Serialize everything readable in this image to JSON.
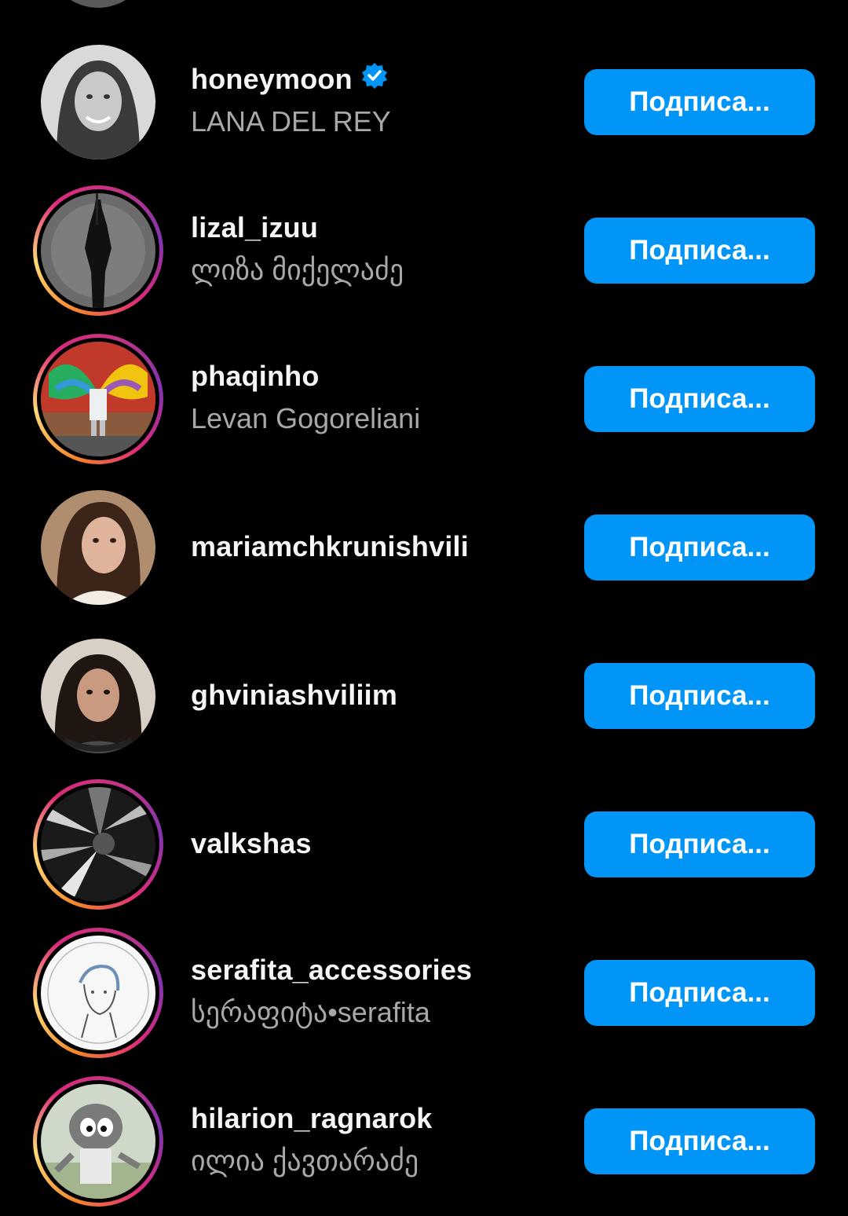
{
  "colors": {
    "background": "#000000",
    "follow_button": "#0095f6",
    "username_text": "#f5f5f5",
    "fullname_text": "#a8a8a8",
    "verified_badge": "#0095f6"
  },
  "rows": [
    {
      "username": "honeymoon",
      "fullname": "LANA DEL REY",
      "verified": true,
      "story_ring": false,
      "button_label": "Подписа..."
    },
    {
      "username": "lizal_izuu",
      "fullname": "ლიზა მიქელაძე",
      "verified": false,
      "story_ring": true,
      "button_label": "Подписа..."
    },
    {
      "username": "phaqinho",
      "fullname": "Levan Gogoreliani",
      "verified": false,
      "story_ring": true,
      "button_label": "Подписа..."
    },
    {
      "username": "mariamchkrunishvili",
      "fullname": "",
      "verified": false,
      "story_ring": false,
      "button_label": "Подписа..."
    },
    {
      "username": "ghviniashviliim",
      "fullname": "",
      "verified": false,
      "story_ring": false,
      "button_label": "Подписа..."
    },
    {
      "username": "valkshas",
      "fullname": "",
      "verified": false,
      "story_ring": true,
      "button_label": "Подписа..."
    },
    {
      "username": "serafita_accessories",
      "fullname": "სერაფიტა•serafita",
      "verified": false,
      "story_ring": true,
      "button_label": "Подписа..."
    },
    {
      "username": "hilarion_ragnarok",
      "fullname": "ილია ქავთარაძე",
      "verified": false,
      "story_ring": true,
      "button_label": "Подписа..."
    }
  ]
}
